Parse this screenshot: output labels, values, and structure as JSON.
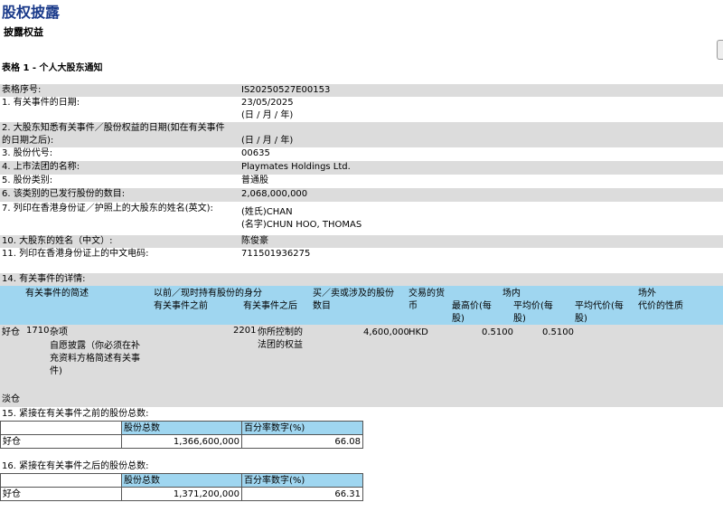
{
  "header": {
    "page_title": "股权披露",
    "sub_title": "披露权益",
    "table_title": "表格 1 - 个人大股东通知"
  },
  "fields": [
    {
      "label": "表格序号:",
      "value": "IS20250527E00153"
    },
    {
      "label": "1. 有关事件的日期:",
      "value": "23/05/2025",
      "note": "(日 / 月 / 年)"
    },
    {
      "label": "2. 大股东知悉有关事件／股份权益的日期(如在有关事件",
      "label2": "的日期之后):",
      "value": "",
      "note": "(日 / 月 / 年)"
    },
    {
      "label": "3. 股份代号:",
      "value": "00635"
    },
    {
      "label": "4. 上市法团的名称:",
      "value": "Playmates Holdings Ltd."
    },
    {
      "label": "5. 股份类别:",
      "value": "普通股"
    },
    {
      "label": "6. 该类别的已发行股份的数目:",
      "value": "2,068,000,000"
    },
    {
      "label": "7. 列印在香港身份证／护照上的大股东的姓名(英文):",
      "value": "(姓氏)CHAN",
      "value2": "(名字)CHUN HOO, THOMAS"
    },
    {
      "label": "10. 大股东的姓名（中文）:",
      "value": "陈俊豪"
    },
    {
      "label": "11. 列印在香港身份证上的中文电码:",
      "value": "711501936275"
    }
  ],
  "details": {
    "title": "14. 有关事件的详情:",
    "headers": {
      "event_code": "有关事件的简述",
      "capacity": "以前／现时持有股份的身分",
      "before": "有关事件之前",
      "after": "有关事件之后",
      "shares": "买／卖或涉及的股份",
      "shares2": "数目",
      "currency": "交易的货",
      "currency2": "币",
      "on_exchange": "场内",
      "highest": "最高价(每",
      "highest2": "股)",
      "avg": "平均价(每",
      "avg2": "股)",
      "off_exchange": "场外",
      "avg_consideration": "平均代价(每",
      "avg_consideration2": "股)",
      "nature": "代价的性质"
    },
    "row": {
      "position": "好仓",
      "code": "1710",
      "desc1": "杂项",
      "desc2": "自愿披露（你必须在补",
      "desc3": "充资料方格简述有关事",
      "desc4": "件)",
      "capacity_code": "2201",
      "capacity1": "你所控制的",
      "capacity2": "法团的权益",
      "shares": "4,600,000",
      "currency": "HKD",
      "highest": "0.5100",
      "avg": "0.5100"
    },
    "short_label": "淡仓"
  },
  "before_total": {
    "title": "15. 紧接在有关事件之前的股份总数:",
    "col1": "股份总数",
    "col2": "百分率数字(%)",
    "row_label": "好仓",
    "shares": "1,366,600,000",
    "percent": "66.08"
  },
  "after_total": {
    "title": "16. 紧接在有关事件之后的股份总数:",
    "col1": "股份总数",
    "col2": "百分率数字(%)",
    "row_label": "好仓",
    "shares": "1,371,200,000",
    "percent": "66.31"
  }
}
